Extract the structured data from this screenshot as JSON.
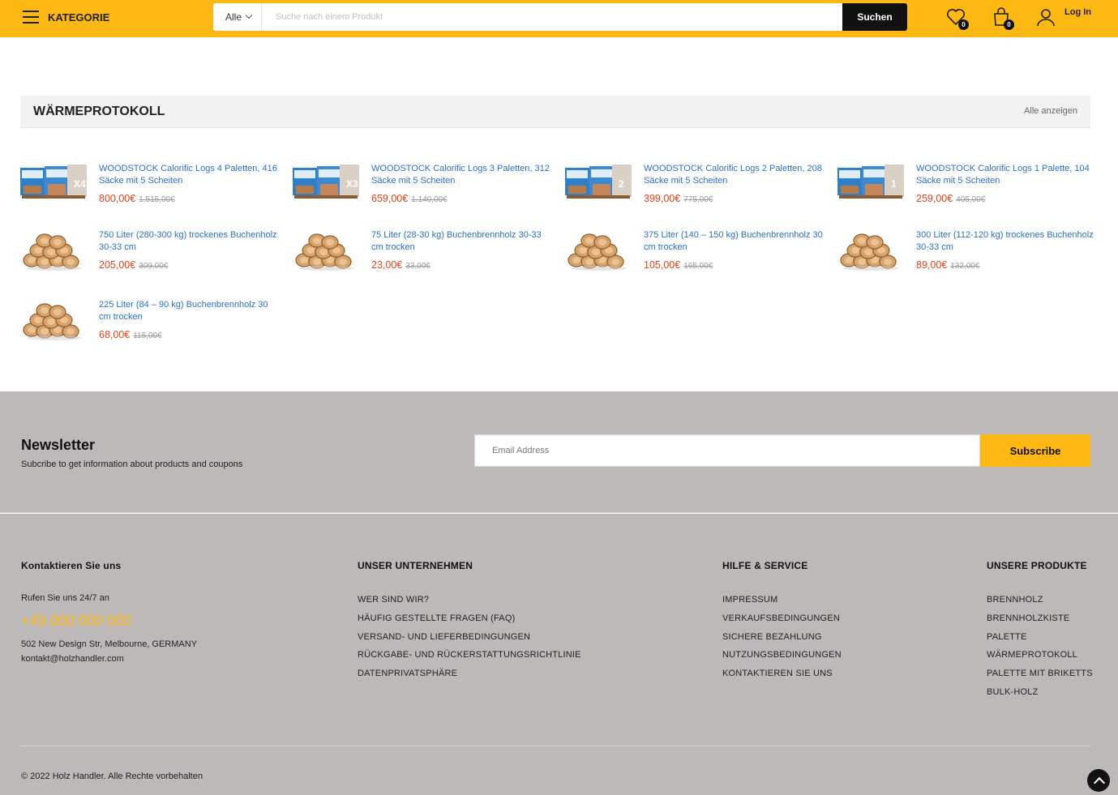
{
  "header": {
    "category_label": "KATEGORIE",
    "search_select": "Alle",
    "search_placeholder": "Suche nach einem Produkt",
    "search_button": "Suchen",
    "wishlist_count": "0",
    "cart_count": "0",
    "login_label": "Log In",
    "accent_color": "#fdb813"
  },
  "section": {
    "title": "WÄRMEPROTOKOLL",
    "view_all": "Alle anzeigen"
  },
  "products": [
    {
      "name": "WOODSTOCK Calorific Logs 4 Paletten, 416 Säcke mit 5 Scheiten",
      "price": "800,00€",
      "old_price": "1.515,00€",
      "image": "pallet-bags-x4",
      "badge": "X4"
    },
    {
      "name": "WOODSTOCK Calorific Logs 3 Paletten, 312 Säcke mit 5 Scheiten",
      "price": "659,00€",
      "old_price": "1.140,00€",
      "image": "pallet-bags-x3",
      "badge": "X3"
    },
    {
      "name": "WOODSTOCK Calorific Logs 2 Paletten, 208 Säcke mit 5 Scheiten",
      "price": "399,00€",
      "old_price": "775,00€",
      "image": "pallet-bags-x2",
      "badge": "2"
    },
    {
      "name": "WOODSTOCK Calorific Logs 1 Palette, 104 Säcke mit 5 Scheiten",
      "price": "259,00€",
      "old_price": "405,00€",
      "image": "pallet-bags-x1",
      "badge": "1"
    },
    {
      "name": "750 Liter (280-300 kg) trockenes Buchenholz 30-33 cm",
      "price": "205,00€",
      "old_price": "309,00€",
      "image": "firewood-stack"
    },
    {
      "name": "75 Liter (28-30 kg) Buchenbrennholz 30-33 cm trocken",
      "price": "23,00€",
      "old_price": "33,00€",
      "image": "firewood-stack"
    },
    {
      "name": "375 Liter (140 – 150 kg) Buchenbrennholz 30 cm trocken",
      "price": "105,00€",
      "old_price": "165,00€",
      "image": "firewood-stack"
    },
    {
      "name": "300 Liter (112-120 kg) trockenes Buchenholz 30-33 cm",
      "price": "89,00€",
      "old_price": "132,00€",
      "image": "firewood-stack"
    },
    {
      "name": "225 Liter (84 – 90 kg) Buchenbrennholz 30 cm trocken",
      "price": "68,00€",
      "old_price": "115,00€",
      "image": "firewood-stack"
    }
  ],
  "newsletter": {
    "title": "Newsletter",
    "subtitle": "Subcribe to get information about products and coupons",
    "email_placeholder": "Email Address",
    "button": "Subscribe"
  },
  "footer": {
    "contact": {
      "heading": "Kontaktieren Sie uns",
      "call_text": "Rufen Sie uns 24/7 an",
      "phone": "+49 000 000 000",
      "address": "502 New Design Str, Melbourne, GERMANY",
      "email": "kontakt@holzhandler.com"
    },
    "columns": [
      {
        "heading": "UNSER UNTERNEHMEN",
        "links": [
          "WER SIND WIR?",
          "HÄUFIG GESTELLTE FRAGEN (FAQ)",
          "VERSAND- UND LIEFERBEDINGUNGEN",
          "RÜCKGABE- UND RÜCKERSTATTUNGSRICHTLINIE",
          "DATENPRIVATSPHÄRE"
        ]
      },
      {
        "heading": "HILFE & SERVICE",
        "links": [
          "IMPRESSUM",
          "VERKAUFSBEDINGUNGEN",
          "SICHERE BEZAHLUNG",
          "NUTZUNGSBEDINGUNGEN",
          "KONTAKTIEREN SIE UNS"
        ]
      },
      {
        "heading": "UNSERE PRODUKTE",
        "links": [
          "BRENNHOLZ",
          "BRENNHOLZKISTE",
          "PALETTE",
          "WÄRMEPROTOKOLL",
          "PALETTE MIT BRIKETTS",
          "BULK-HOLZ"
        ]
      }
    ],
    "copyright": "© 2022 Holz Handler. Alle Rechte vorbehalten"
  }
}
